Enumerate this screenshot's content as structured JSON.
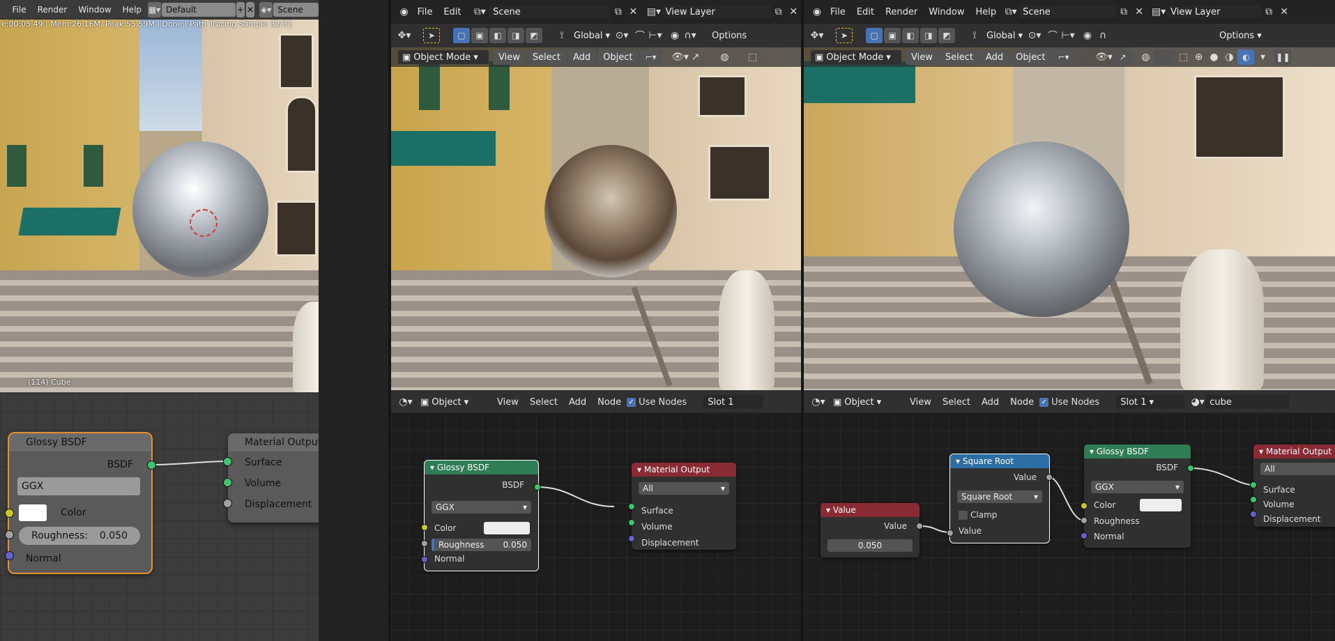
{
  "left": {
    "menu": [
      "File",
      "Render",
      "Window",
      "Help"
    ],
    "screen_layout": "Default",
    "scene": "Scene",
    "render_status": "e:00:05.49 | Mem:26.16M, Peak:55.59M | Done | Path Tracing Sample 32/32",
    "object_info": "(114) Cube",
    "node_glossy": {
      "title": "Glossy BSDF",
      "output": "BSDF",
      "distribution": "GGX",
      "color_label": "Color",
      "roughness_label": "Roughness:",
      "roughness": "0.050",
      "normal": "Normal"
    },
    "node_output": {
      "title": "Material Output",
      "surface": "Surface",
      "volume": "Volume",
      "displacement": "Displacement"
    }
  },
  "middle": {
    "menu": [
      "File",
      "Edit"
    ],
    "scene": "Scene",
    "view_layer": "View Layer",
    "orientation": "Global",
    "options": "Options",
    "mode": "Object Mode",
    "view_menu": [
      "View",
      "Select",
      "Add",
      "Object"
    ],
    "node_header": {
      "type": "Object",
      "menu": [
        "View",
        "Select",
        "Add",
        "Node"
      ],
      "use_nodes": "Use Nodes",
      "slot": "Slot 1"
    },
    "node_glossy": {
      "title": "Glossy BSDF",
      "output": "BSDF",
      "distribution": "GGX",
      "color_label": "Color",
      "roughness_label": "Roughness",
      "roughness": "0.050",
      "normal": "Normal"
    },
    "node_output": {
      "title": "Material Output",
      "target": "All",
      "surface": "Surface",
      "volume": "Volume",
      "displacement": "Displacement"
    }
  },
  "right": {
    "menu": [
      "File",
      "Edit",
      "Render",
      "Window",
      "Help"
    ],
    "scene": "Scene",
    "view_layer": "View Layer",
    "orientation": "Global",
    "options": "Options",
    "mode": "Object Mode",
    "view_menu": [
      "View",
      "Select",
      "Add",
      "Object"
    ],
    "node_header": {
      "type": "Object",
      "menu": [
        "View",
        "Select",
        "Add",
        "Node"
      ],
      "use_nodes": "Use Nodes",
      "slot": "Slot 1",
      "material": "cube"
    },
    "node_value": {
      "title": "Value",
      "output": "Value",
      "value": "0.050"
    },
    "node_sqrt": {
      "title": "Square Root",
      "output": "Value",
      "operation": "Square Root",
      "clamp": "Clamp",
      "input": "Value"
    },
    "node_glossy": {
      "title": "Glossy BSDF",
      "output": "BSDF",
      "distribution": "GGX",
      "color_label": "Color",
      "roughness_label": "Roughness",
      "normal": "Normal"
    },
    "node_output": {
      "title": "Material Output",
      "target": "All",
      "surface": "Surface",
      "volume": "Volume",
      "displacement": "Displacement"
    }
  },
  "colors": {
    "accent": "#4772b3",
    "socket_shader": "#3ec46d",
    "socket_color": "#c7c729",
    "socket_float": "#a1a1a1",
    "socket_vector": "#6363c7"
  }
}
